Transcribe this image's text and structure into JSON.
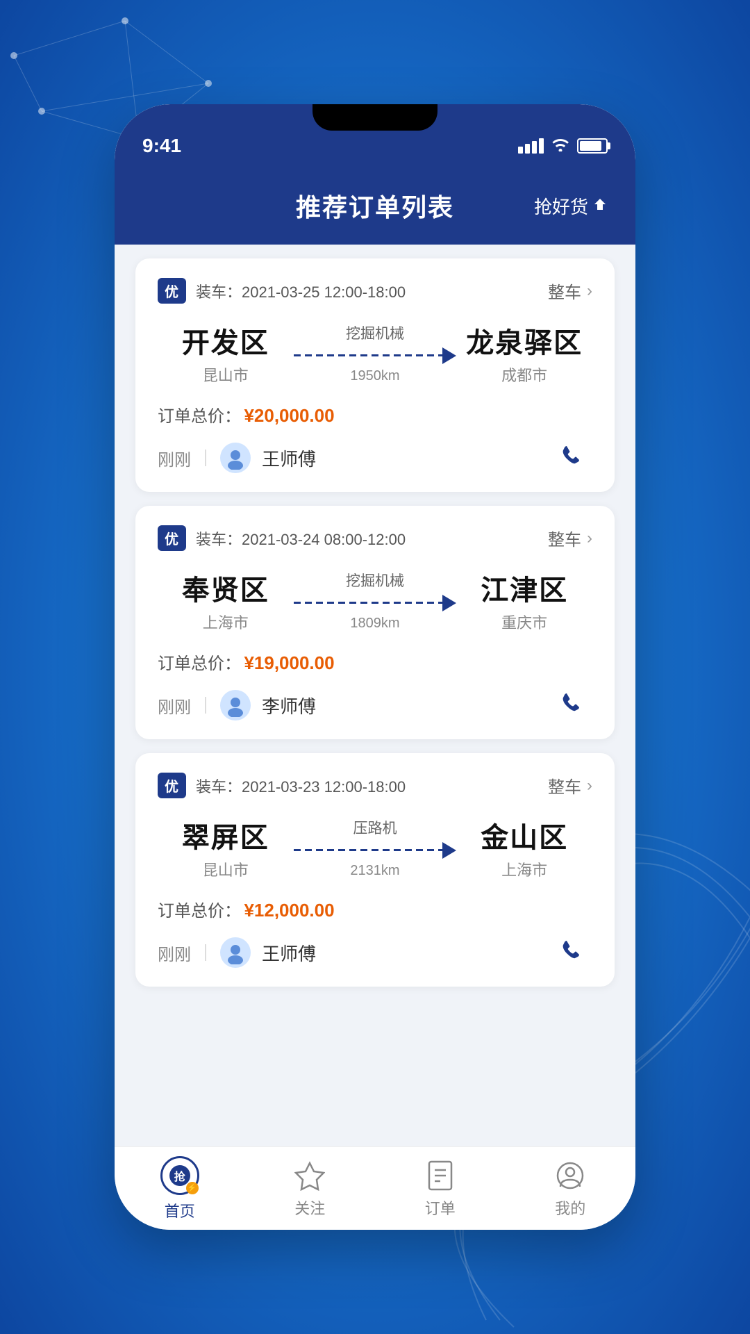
{
  "status_bar": {
    "time": "9:41"
  },
  "header": {
    "title": "推荐订单列表",
    "action": "抢好货"
  },
  "orders": [
    {
      "badge": "优",
      "loading_time": "装车：2021-03-25 12:00-18:00",
      "type": "整车",
      "from_city": "开发区",
      "from_sub": "昆山市",
      "goods": "挖掘机械",
      "distance": "1950km",
      "to_city": "龙泉驿区",
      "to_sub": "成都市",
      "price_label": "订单总价：",
      "price": "¥20,000.00",
      "driver_time": "刚刚",
      "driver_name": "王师傅"
    },
    {
      "badge": "优",
      "loading_time": "装车：2021-03-24 08:00-12:00",
      "type": "整车",
      "from_city": "奉贤区",
      "from_sub": "上海市",
      "goods": "挖掘机械",
      "distance": "1809km",
      "to_city": "江津区",
      "to_sub": "重庆市",
      "price_label": "订单总价：",
      "price": "¥19,000.00",
      "driver_time": "刚刚",
      "driver_name": "李师傅"
    },
    {
      "badge": "优",
      "loading_time": "装车：2021-03-23 12:00-18:00",
      "type": "整车",
      "from_city": "翠屏区",
      "from_sub": "昆山市",
      "goods": "压路机",
      "distance": "2131km",
      "to_city": "金山区",
      "to_sub": "上海市",
      "price_label": "订单总价：",
      "price": "¥12,000.00",
      "driver_time": "刚刚",
      "driver_name": "王师傅"
    }
  ],
  "bottom_nav": [
    {
      "label": "首页",
      "active": true
    },
    {
      "label": "关注",
      "active": false
    },
    {
      "label": "订单",
      "active": false
    },
    {
      "label": "我的",
      "active": false
    }
  ]
}
